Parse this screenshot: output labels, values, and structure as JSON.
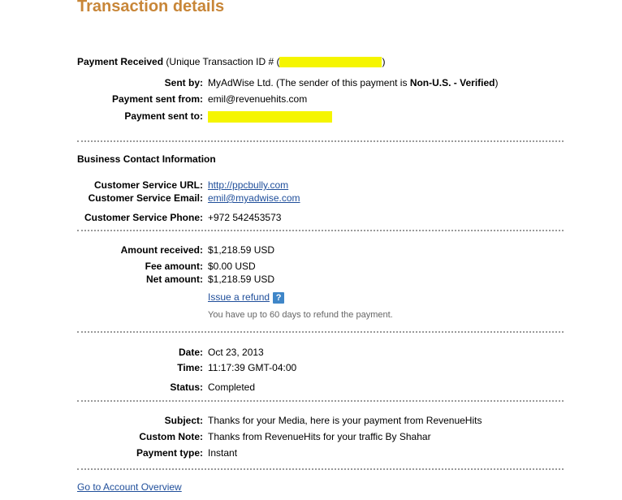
{
  "page": {
    "title": "Transaction details"
  },
  "header": {
    "payment_received_label": "Payment Received",
    "transaction_id_prefix": "(Unique Transaction ID # (",
    "transaction_id_suffix": ")",
    "redaction_color": "#f5f500"
  },
  "payment": {
    "sent_by_label": "Sent by:",
    "sent_by_name": "MyAdWise Ltd.",
    "sender_note_prefix": "(The sender of this payment is",
    "sender_status": "Non-U.S. - Verified",
    "sender_note_suffix": ")",
    "sent_from_label": "Payment sent from:",
    "sent_from_value": "emil@revenuehits.com",
    "sent_to_label": "Payment sent to:"
  },
  "business": {
    "section_title": "Business Contact Information",
    "url_label": "Customer Service URL:",
    "url_value": "http://ppcbully.com",
    "email_label": "Customer Service Email:",
    "email_value": "emil@myadwise.com",
    "phone_label": "Customer Service Phone:",
    "phone_value": "+972 542453573"
  },
  "amounts": {
    "received_label": "Amount received:",
    "received_value": "$1,218.59 USD",
    "fee_label": "Fee amount:",
    "fee_value": "$0.00 USD",
    "net_label": "Net amount:",
    "net_value": "$1,218.59 USD",
    "refund_link": "Issue a refund",
    "help_icon_glyph": "?",
    "refund_note": "You have up to 60 days to refund the payment."
  },
  "timing": {
    "date_label": "Date:",
    "date_value": "Oct 23, 2013",
    "time_label": "Time:",
    "time_value": "11:17:39 GMT-04:00",
    "status_label": "Status:",
    "status_value": "Completed"
  },
  "details": {
    "subject_label": "Subject:",
    "subject_value": "Thanks for your Media, here is your payment from RevenueHits",
    "note_label": "Custom Note:",
    "note_value": "Thanks from RevenueHits for your traffic By Shahar",
    "type_label": "Payment type:",
    "type_value": "Instant"
  },
  "footer": {
    "overview_link": "Go to Account Overview"
  },
  "colors": {
    "title": "#c88638",
    "link": "#1f4e9a",
    "help_icon": "#3f86c8",
    "divider": "#9a9a9a"
  }
}
